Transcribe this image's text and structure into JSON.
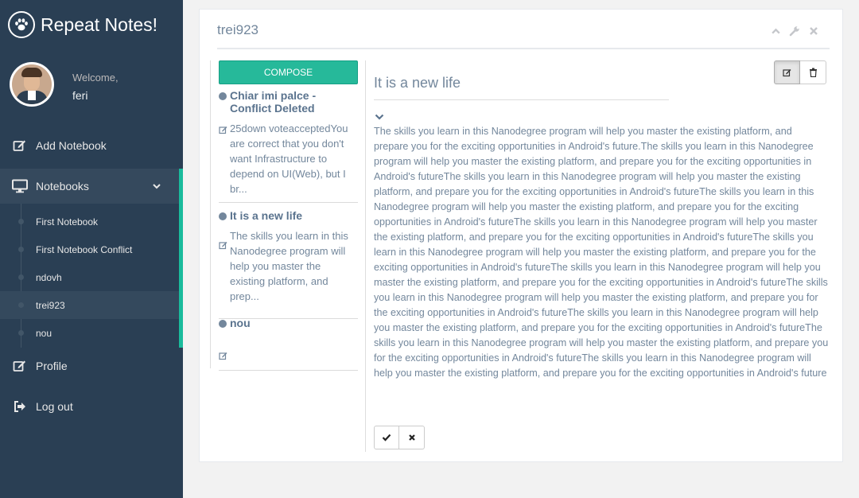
{
  "app": {
    "title": "Repeat Notes!"
  },
  "profile": {
    "welcome": "Welcome,",
    "name": "feri"
  },
  "menu": {
    "add_notebook": "Add Notebook",
    "notebooks": "Notebooks",
    "notebook_items": [
      "First Notebook",
      "First Notebook Conflict",
      "ndovh",
      "trei923",
      "nou"
    ],
    "profile": "Profile",
    "logout": "Log out"
  },
  "panel": {
    "title": "trei923"
  },
  "compose_label": "COMPOSE",
  "notes": [
    {
      "title": "Chiar imi palce - Conflict Deleted",
      "preview": "25down voteacceptedYou are correct that you don't want Infrastructure to depend on UI(Web), but I br..."
    },
    {
      "title": "It is a new life",
      "preview": "The skills you learn in this Nanodegree program will help you master the existing platform, and prep..."
    },
    {
      "title": "nou",
      "preview": ""
    }
  ],
  "note_view": {
    "subject": "It is a new life",
    "body": "The skills you learn in this Nanodegree program will help you master the existing platform, and prepare you for the exciting opportunities in Android's future.The skills you learn in this Nanodegree program will help you master the existing platform, and prepare you for the exciting opportunities in Android's futureThe skills you learn in this Nanodegree program will help you master the existing platform, and prepare you for the exciting opportunities in Android's futureThe skills you learn in this Nanodegree program will help you master the existing platform, and prepare you for the exciting opportunities in Android's futureThe skills you learn in this Nanodegree program will help you master the existing platform, and prepare you for the exciting opportunities in Android's futureThe skills you learn in this Nanodegree program will help you master the existing platform, and prepare you for the exciting opportunities in Android's futureThe skills you learn in this Nanodegree program will help you master the existing platform, and prepare you for the exciting opportunities in Android's futureThe skills you learn in this Nanodegree program will help you master the existing platform, and prepare you for the exciting opportunities in Android's futureThe skills you learn in this Nanodegree program will help you master the existing platform, and prepare you for the exciting opportunities in Android's futureThe skills you learn in this Nanodegree program will help you master the existing platform, and prepare you for the exciting opportunities in Android's futureThe skills you learn in this Nanodegree program will help you master the existing platform, and prepare you for the exciting opportunities in Android's future"
  },
  "colors": {
    "sidebar": "#2a3f54",
    "accent": "#1abb9c",
    "compose": "#26b99a",
    "text": "#73879c"
  }
}
